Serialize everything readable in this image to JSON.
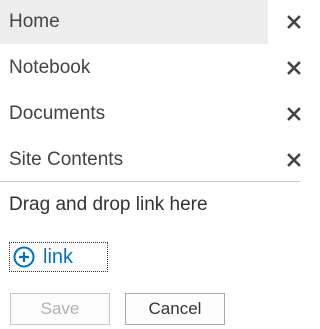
{
  "nav": {
    "items": [
      {
        "label": "Home",
        "selected": true,
        "remove_icon": "close-icon"
      },
      {
        "label": "Notebook",
        "selected": false,
        "remove_icon": "close-icon"
      },
      {
        "label": "Documents",
        "selected": false,
        "remove_icon": "close-icon"
      },
      {
        "label": "Site Contents",
        "selected": false,
        "remove_icon": "close-icon"
      }
    ]
  },
  "drop_hint": "Drag and drop link here",
  "add_link": {
    "label": "link",
    "icon": "plus-circle-icon",
    "color": "#0072c6"
  },
  "actions": {
    "save_label": "Save",
    "save_disabled": true,
    "cancel_label": "Cancel"
  },
  "colors": {
    "selected_bg": "#ededed",
    "link": "#0072c6",
    "remove_icon": "#444444"
  }
}
